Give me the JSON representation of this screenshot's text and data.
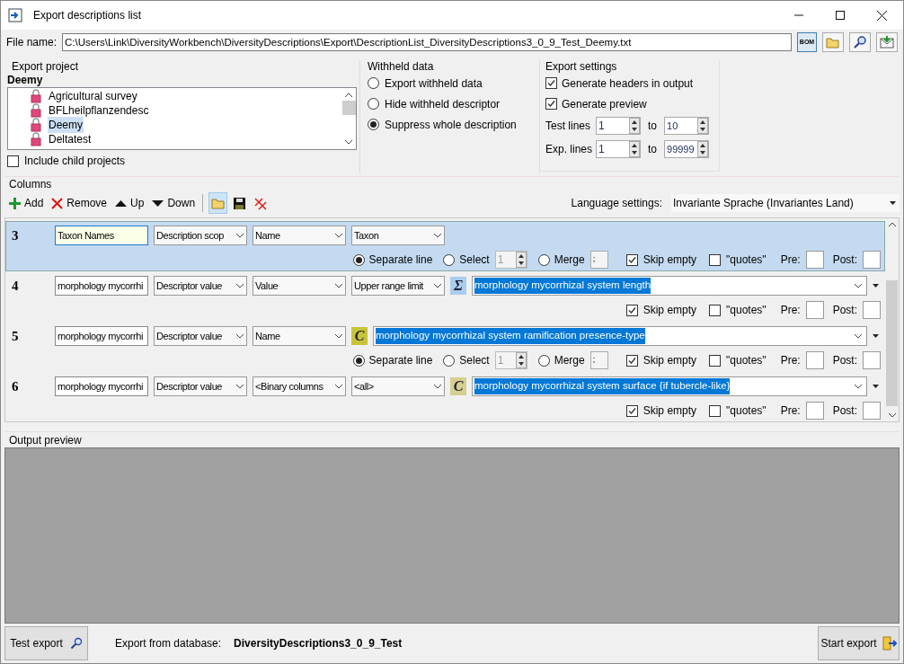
{
  "window": {
    "title": "Export descriptions list"
  },
  "file": {
    "label": "File name:",
    "value": "C:\\Users\\Link\\DiversityWorkbench\\DiversityDescriptions\\Export\\DescriptionList_DiversityDescriptions3_0_9_Test_Deemy.txt",
    "bom": "BOM"
  },
  "export_project": {
    "title": "Export project",
    "current": "Deemy",
    "items": [
      {
        "label": "Agricultural survey",
        "selected": false
      },
      {
        "label": "BFLheilpflanzendesc",
        "selected": false
      },
      {
        "label": "Deemy",
        "selected": true
      },
      {
        "label": "Deltatest",
        "selected": false
      }
    ],
    "include_child": {
      "label": "Include child projects",
      "checked": false
    }
  },
  "withheld": {
    "title": "Withheld data",
    "options": [
      {
        "label": "Export withheld data",
        "selected": false
      },
      {
        "label": "Hide withheld descriptor",
        "selected": false
      },
      {
        "label": "Suppress whole description",
        "selected": true
      }
    ]
  },
  "export_settings": {
    "title": "Export settings",
    "checks": [
      {
        "label": "Generate headers in output",
        "checked": true
      },
      {
        "label": "Generate preview",
        "checked": true
      }
    ],
    "lines": [
      {
        "label": "Test lines",
        "from": "1",
        "to_label": "to",
        "to": "10"
      },
      {
        "label": "Exp. lines",
        "from": "1",
        "to_label": "to",
        "to": "99999"
      }
    ]
  },
  "columns": {
    "title": "Columns",
    "toolbar": [
      {
        "kind": "add",
        "label": "Add"
      },
      {
        "kind": "remove",
        "label": "Remove"
      },
      {
        "kind": "up",
        "label": "Up"
      },
      {
        "kind": "down",
        "label": "Down"
      },
      {
        "kind": "open"
      },
      {
        "kind": "save"
      },
      {
        "kind": "clear"
      }
    ],
    "language_label": "Language settings:",
    "language": "Invariante Sprache (Invariantes Land)",
    "rows": [
      {
        "number": "3",
        "selected": true,
        "name": "Taxon Names",
        "dropdowns": [
          "Description scop",
          "Name",
          "Taxon"
        ],
        "radios": [
          {
            "label": "Separate line",
            "selected": true
          },
          {
            "label": "Select",
            "selected": false
          },
          {
            "label": "Merge",
            "selected": false
          }
        ],
        "select_value": "1",
        "merge_value": ";",
        "skip": {
          "label": "Skip empty",
          "checked": true
        },
        "quotes": {
          "label": "\"quotes\"",
          "checked": false
        },
        "pre_label": "Pre:",
        "post_label": "Post:"
      },
      {
        "number": "4",
        "selected": false,
        "name": "morphology mycorrhi",
        "dropdowns": [
          "Descriptor value",
          "Value",
          "Upper range limit"
        ],
        "marker": {
          "kind": "sum",
          "glyph": "Σ"
        },
        "descriptor": "morphology mycorrhizal system length",
        "skip": {
          "label": "Skip empty",
          "checked": true
        },
        "quotes": {
          "label": "\"quotes\"",
          "checked": false
        },
        "pre_label": "Pre:",
        "post_label": "Post:"
      },
      {
        "number": "5",
        "selected": false,
        "name": "morphology mycorrhi",
        "dropdowns": [
          "Descriptor value",
          "Name"
        ],
        "marker": {
          "kind": "categorical",
          "glyph": "C"
        },
        "descriptor": "morphology mycorrhizal system ramification presence-type",
        "radios": [
          {
            "label": "Separate line",
            "selected": true
          },
          {
            "label": "Select",
            "selected": false
          },
          {
            "label": "Merge",
            "selected": false
          }
        ],
        "select_value": "1",
        "merge_value": ";",
        "skip": {
          "label": "Skip empty",
          "checked": true
        },
        "quotes": {
          "label": "\"quotes\"",
          "checked": false
        },
        "pre_label": "Pre:",
        "post_label": "Post:"
      },
      {
        "number": "6",
        "selected": false,
        "name": "morphology mycorrhi",
        "dropdowns": [
          "Descriptor value",
          "<Binary columns",
          "<all>"
        ],
        "marker": {
          "kind": "categorical_binary",
          "glyph": "C"
        },
        "descriptor": "morphology mycorrhizal system surface {if tubercle-like}",
        "skip": {
          "label": "Skip empty",
          "checked": true
        },
        "quotes": {
          "label": "\"quotes\"",
          "checked": false
        },
        "pre_label": "Pre:",
        "post_label": "Post:"
      }
    ]
  },
  "output_preview": {
    "title": "Output preview"
  },
  "footer": {
    "test_button": "Test export",
    "database_label": "Export from database:",
    "database": "DiversityDescriptions3_0_9_Test",
    "start_button": "Start export"
  }
}
